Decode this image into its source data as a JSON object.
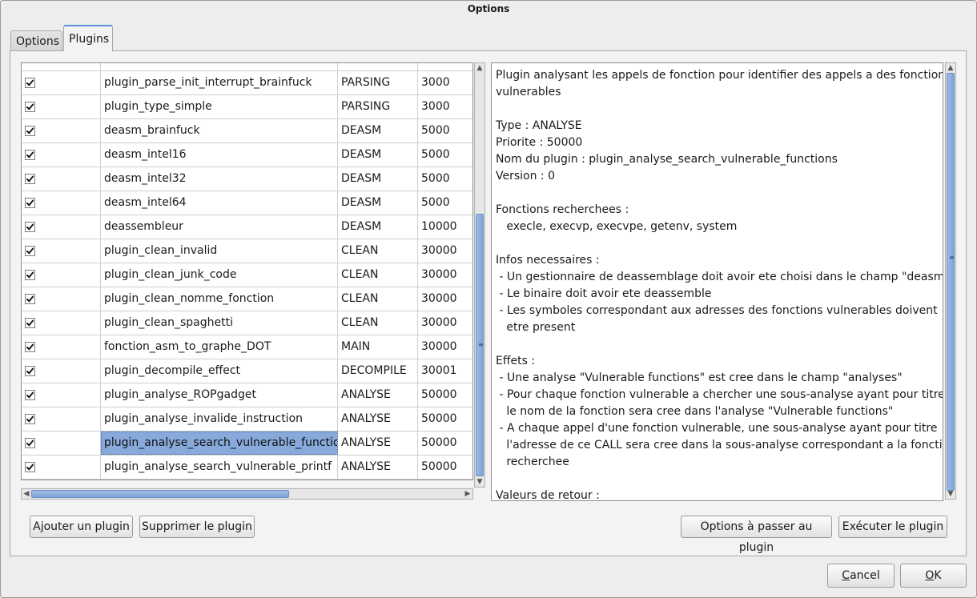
{
  "window": {
    "title": "Options"
  },
  "tabs": [
    {
      "label": "Options"
    },
    {
      "label": "Plugins"
    }
  ],
  "plugins": [
    {
      "name": "plugin_parse_init_interrupt_brainfuck",
      "type": "PARSING",
      "priority": "3000"
    },
    {
      "name": "plugin_type_simple",
      "type": "PARSING",
      "priority": "3000"
    },
    {
      "name": "deasm_brainfuck",
      "type": "DEASM",
      "priority": "5000"
    },
    {
      "name": "deasm_intel16",
      "type": "DEASM",
      "priority": "5000"
    },
    {
      "name": "deasm_intel32",
      "type": "DEASM",
      "priority": "5000"
    },
    {
      "name": "deasm_intel64",
      "type": "DEASM",
      "priority": "5000"
    },
    {
      "name": "deassembleur",
      "type": "DEASM",
      "priority": "10000"
    },
    {
      "name": "plugin_clean_invalid",
      "type": "CLEAN",
      "priority": "30000"
    },
    {
      "name": "plugin_clean_junk_code",
      "type": "CLEAN",
      "priority": "30000"
    },
    {
      "name": "plugin_clean_nomme_fonction",
      "type": "CLEAN",
      "priority": "30000"
    },
    {
      "name": "plugin_clean_spaghetti",
      "type": "CLEAN",
      "priority": "30000"
    },
    {
      "name": "fonction_asm_to_graphe_DOT",
      "type": "MAIN",
      "priority": "30000"
    },
    {
      "name": "plugin_decompile_effect",
      "type": "DECOMPILE",
      "priority": "30001"
    },
    {
      "name": "plugin_analyse_ROPgadget",
      "type": "ANALYSE",
      "priority": "50000"
    },
    {
      "name": "plugin_analyse_invalide_instruction",
      "type": "ANALYSE",
      "priority": "50000"
    },
    {
      "name": "plugin_analyse_search_vulnerable_functions",
      "type": "ANALYSE",
      "priority": "50000",
      "selected": true
    },
    {
      "name": "plugin_analyse_search_vulnerable_printf",
      "type": "ANALYSE",
      "priority": "50000"
    }
  ],
  "description": [
    "Plugin analysant les appels de fonction pour identifier des appels a des fonctions",
    "vulnerables",
    "",
    "Type : ANALYSE",
    "Priorite : 50000",
    "Nom du plugin : plugin_analyse_search_vulnerable_functions",
    "Version : 0",
    "",
    "Fonctions recherchees :",
    "   execle, execvp, execvpe, getenv, system",
    "",
    "Infos necessaires :",
    " - Un gestionnaire de deassemblage doit avoir ete choisi dans le champ \"deasm\"",
    " - Le binaire doit avoir ete deassemble",
    " - Les symboles correspondant aux adresses des fonctions vulnerables doivent",
    "   etre present",
    "",
    "Effets :",
    " - Une analyse \"Vulnerable functions\" est cree dans le champ \"analyses\"",
    " - Pour chaque fonction vulnerable a chercher une sous-analyse ayant pour titre",
    "   le nom de la fonction sera cree dans l'analyse \"Vulnerable functions\"",
    " - A chaque appel d'une fonction vulnerable, une sous-analyse ayant pour titre",
    "   l'adresse de ce CALL sera cree dans la sous-analyse correspondant a la fonction",
    "   recherchee",
    "",
    "Valeurs de retour :"
  ],
  "buttons": {
    "add_plugin": "Ajouter un plugin",
    "remove_plugin": "Supprimer le plugin",
    "plugin_options": "Options à passer au plugin",
    "run_plugin": "Exécuter le plugin",
    "cancel_first": "C",
    "cancel_rest": "ancel",
    "ok_first": "O",
    "ok_rest": "K"
  },
  "colors": {
    "selection": "#88aadb",
    "scroll_thumb": "#7ea4d8"
  }
}
